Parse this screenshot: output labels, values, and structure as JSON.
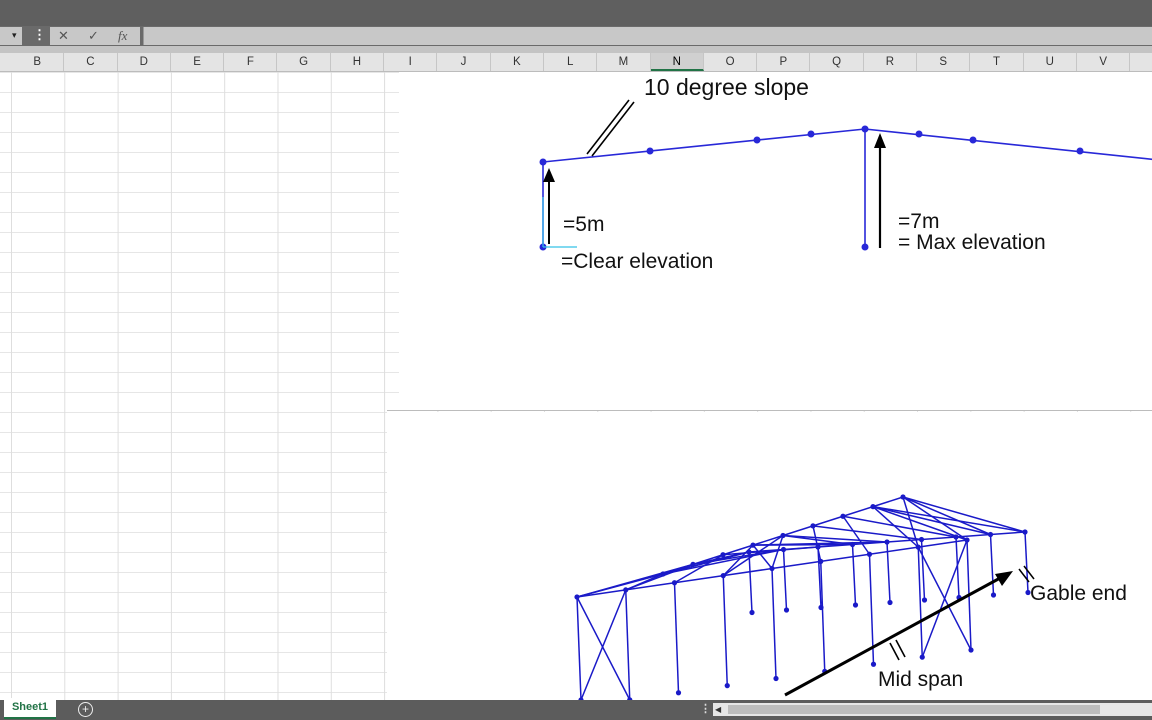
{
  "formula_bar": {
    "name_box_arrow": "▾",
    "menu_glyph": "⋮",
    "cancel_glyph": "✕",
    "enter_glyph": "✓",
    "function_glyph": "fx",
    "formula_value": ""
  },
  "columns": [
    "B",
    "C",
    "D",
    "E",
    "F",
    "G",
    "H",
    "I",
    "J",
    "K",
    "L",
    "M",
    "N",
    "O",
    "P",
    "Q",
    "R",
    "S",
    "T",
    "U",
    "V"
  ],
  "selected_column": "N",
  "chart_top": {
    "slope_label": "10 degree slope",
    "clear_height": "=5m",
    "clear_label": "=Clear elevation",
    "max_height": "=7m",
    "max_label": "= Max elevation",
    "frame_color": "#2828d8"
  },
  "chart_bottom": {
    "gable_label": "Gable end",
    "midspan_label": "Mid span",
    "frame_color": "#1a1ac8"
  },
  "status_bar": {
    "sheet_tab": "Sheet1",
    "add_sheet": "+",
    "scroll_dots": "⋮",
    "scroll_left": "◀"
  }
}
